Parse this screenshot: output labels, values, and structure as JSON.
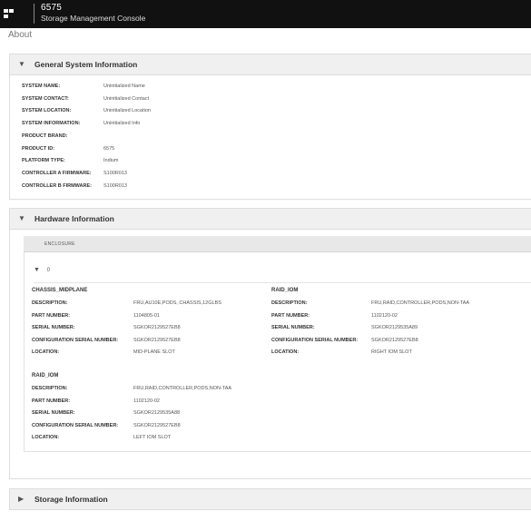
{
  "header": {
    "model": "6575",
    "console_title": "Storage Management Console"
  },
  "page_title": "About",
  "general": {
    "title": "General System Information",
    "rows": [
      {
        "label": "SYSTEM NAME:",
        "value": "Uninitialized Name"
      },
      {
        "label": "SYSTEM CONTACT:",
        "value": "Uninitialized Contact"
      },
      {
        "label": "SYSTEM LOCATION:",
        "value": "Uninitialized Location"
      },
      {
        "label": "SYSTEM INFORMATION:",
        "value": "Uninitialized Info"
      },
      {
        "label": "PRODUCT BRAND:",
        "value": ""
      },
      {
        "label": "PRODUCT ID:",
        "value": "6575"
      },
      {
        "label": "PLATFORM TYPE:",
        "value": "Indium"
      },
      {
        "label": "CONTROLLER A FIRMWARE:",
        "value": "S100R013"
      },
      {
        "label": "CONTROLLER B FIRMWARE:",
        "value": "S100R013"
      }
    ]
  },
  "hardware": {
    "title": "Hardware Information",
    "enclosure_label": "ENCLOSURE",
    "enclosure_id": "0",
    "chassis": {
      "title": "CHASSIS_MIDPLANE",
      "rows": [
        {
          "label": "DESCRIPTION:",
          "value": "FRU,AU10E,PODS, CHASSIS,12GLBS"
        },
        {
          "label": "PART NUMBER:",
          "value": "1104805-01"
        },
        {
          "label": "SERIAL NUMBER:",
          "value": "SGKOR2129527EB8"
        },
        {
          "label": "CONFIGURATION SERIAL NUMBER:",
          "value": "SGKOR2129527EB8"
        },
        {
          "label": "LOCATION:",
          "value": "MID-PLANE SLOT"
        }
      ]
    },
    "raid_right": {
      "title": "RAID_IOM",
      "rows": [
        {
          "label": "DESCRIPTION:",
          "value": "FRU,RAID,CONTROLLER,PODS,NON-TAA"
        },
        {
          "label": "PART NUMBER:",
          "value": "1102120-02"
        },
        {
          "label": "SERIAL NUMBER:",
          "value": "SGKOR2129535A89"
        },
        {
          "label": "CONFIGURATION SERIAL NUMBER:",
          "value": "SGKOR2129527EB8"
        },
        {
          "label": "LOCATION:",
          "value": "RIGHT IOM SLOT"
        }
      ]
    },
    "raid_left": {
      "title": "RAID_IOM",
      "rows": [
        {
          "label": "DESCRIPTION:",
          "value": "FRU,RAID,CONTROLLER,PODS,NON-TAA"
        },
        {
          "label": "PART NUMBER:",
          "value": "1102120-02"
        },
        {
          "label": "SERIAL NUMBER:",
          "value": "SGKOR2129535A88"
        },
        {
          "label": "CONFIGURATION SERIAL NUMBER:",
          "value": "SGKOR2129527EB8"
        },
        {
          "label": "LOCATION:",
          "value": "LEFT IOM SLOT"
        }
      ]
    }
  },
  "storage": {
    "title": "Storage Information"
  },
  "icons": {
    "expanded": "chevron-down-icon",
    "collapsed": "chevron-right-icon",
    "logo": "logo-icon"
  }
}
